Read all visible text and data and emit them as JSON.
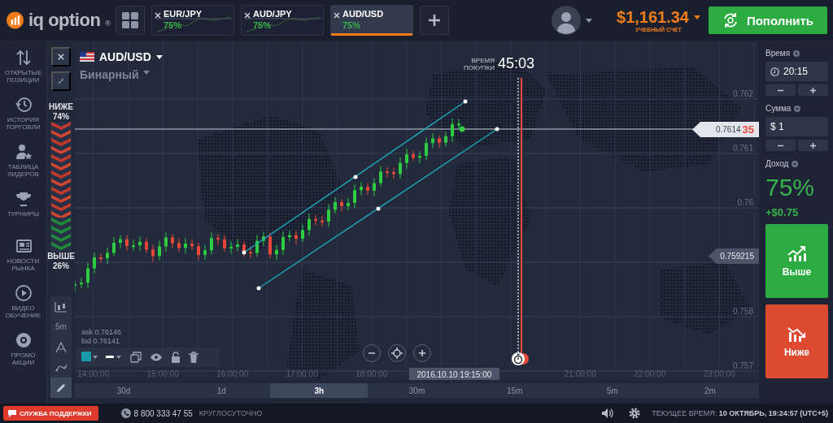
{
  "logo": {
    "text": "iq option",
    "mark": "®"
  },
  "asset_tabs": [
    {
      "pair": "EUR/JPY",
      "payout": "75%",
      "selected": false
    },
    {
      "pair": "AUD/JPY",
      "payout": "75%",
      "selected": false
    },
    {
      "pair": "AUD/USD",
      "payout": "75%",
      "selected": true
    }
  ],
  "account": {
    "balance": "$1,161.34",
    "type": "УЧЕБНЫЙ СЧЕТ"
  },
  "deposit_button": "Пополнить",
  "sidebar": {
    "items": [
      {
        "kind": "positions",
        "label": "ОТКРЫТЫЕ ПОЗИЦИИ"
      },
      {
        "kind": "history",
        "label": "ИСТОРИЯ ТОРГОВЛИ"
      },
      {
        "kind": "leaders",
        "label": "ТАБЛИЦА ЛИДЕРОВ"
      },
      {
        "kind": "tournaments",
        "label": "ТУРНИРЫ"
      },
      {
        "kind": "news",
        "label": "НОВОСТИ РЫНКА"
      },
      {
        "kind": "video",
        "label": "ВИДЕО ОБУЧЕНИЕ"
      },
      {
        "kind": "promo",
        "label": "ПРОМО АКЦИИ"
      }
    ]
  },
  "chart_tools": [
    {
      "kind": "candles",
      "selected": false
    },
    {
      "kind": "interval",
      "label": "5m",
      "selected": false
    },
    {
      "kind": "indicator",
      "selected": false
    },
    {
      "kind": "wave",
      "selected": false
    },
    {
      "kind": "pencil",
      "selected": true
    }
  ],
  "chart": {
    "asset": "AUD/USD",
    "option_type": "Бинарный",
    "purchase_time_label": "ВРЕМЯ ПОКУПКИ",
    "purchase_countdown": "45:03",
    "sentiment": {
      "down_label": "НИЖЕ",
      "down_percent": "74%",
      "up_label": "ВЫШЕ",
      "up_percent": "26%",
      "level": 0.74
    },
    "current_price": {
      "main": "0.7614",
      "tail": "35"
    },
    "price_axis": [
      {
        "kind": "tick",
        "label": "0.762"
      },
      {
        "kind": "tick",
        "label": "0.761"
      },
      {
        "kind": "tick",
        "label": "0.76"
      },
      {
        "kind": "marker",
        "label": "0.759215"
      },
      {
        "kind": "tick",
        "label": "0.758"
      },
      {
        "kind": "tick",
        "label": "0.757"
      }
    ],
    "time_axis": [
      {
        "kind": "tick",
        "label": "14:00:00"
      },
      {
        "kind": "tick",
        "label": "15:00:00"
      },
      {
        "kind": "tick",
        "label": "16:00:00"
      },
      {
        "kind": "tick",
        "label": "17:00:00"
      },
      {
        "kind": "tick",
        "label": "18:00:00"
      },
      {
        "kind": "cursor",
        "label": "2016.10.10 19:15:00"
      },
      {
        "kind": "tick",
        "label": "21:00:00"
      },
      {
        "kind": "tick",
        "label": "22:00:00"
      },
      {
        "kind": "tick",
        "label": "23:00:00"
      }
    ],
    "quote": {
      "ask": "ask 0.76146",
      "bid": "bid 0.76141"
    }
  },
  "timeframes": [
    {
      "label": "30d",
      "selected": false
    },
    {
      "label": "1d",
      "selected": false
    },
    {
      "label": "3h",
      "selected": true
    },
    {
      "label": "30m",
      "selected": false
    },
    {
      "label": "15m",
      "selected": false
    },
    {
      "label": "5m",
      "selected": false
    },
    {
      "label": "2m",
      "selected": false
    }
  ],
  "trade_panel": {
    "time_label": "Время",
    "time_value": "20:15",
    "amount_label": "Сумма",
    "amount_currency": "$",
    "amount_value": "1",
    "income_label": "Доход",
    "income_percent": "75%",
    "income_value": "+$0.75",
    "call_button": "Выше",
    "put_button": "Ниже"
  },
  "status_bar": {
    "support_button": "СЛУЖБА ПОДДЕРЖКИ",
    "phone": "8 800 333 47 55",
    "hours": "КРУГЛОСУТОЧНО",
    "current_time": "ТЕКУЩЕЕ ВРЕМЯ: **10 ОКТЯБРЬ, 19:24:57 (UTC+5)**"
  }
}
